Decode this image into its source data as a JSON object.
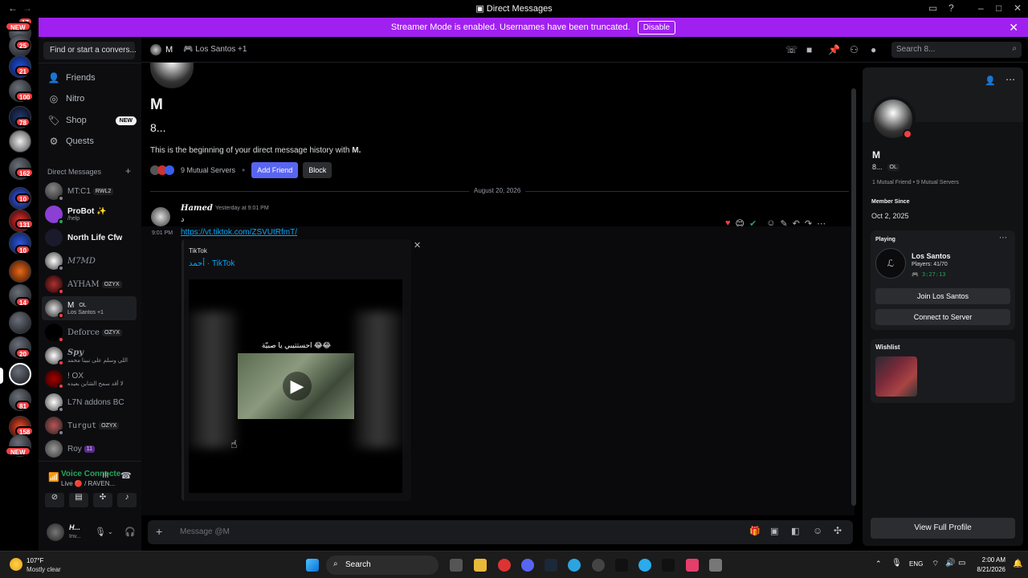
{
  "window": {
    "title": "Direct Messages"
  },
  "banner": {
    "text": "Streamer Mode is enabled. Usernames have been truncated.",
    "button": "Disable"
  },
  "rail": {
    "badges": [
      "17",
      "NEW",
      "25",
      "21",
      "100",
      "78",
      "162",
      "10",
      "131",
      "10",
      "14",
      "20",
      "81",
      "158",
      "NEW"
    ]
  },
  "sidebar": {
    "search_placeholder": "Find or start a convers...",
    "nav": [
      {
        "label": "Friends",
        "icon": "friends-icon"
      },
      {
        "label": "Nitro",
        "icon": "nitro-icon"
      },
      {
        "label": "Shop",
        "icon": "shop-icon",
        "badge": "NEW"
      },
      {
        "label": "Quests",
        "icon": "quests-icon"
      }
    ],
    "dm_header": "Direct Messages",
    "dms": [
      {
        "name": "MT:C1",
        "tag": "RWL2",
        "sub": ""
      },
      {
        "name": "ProBot ✨",
        "tag": "",
        "sub": "/help"
      },
      {
        "name": "North Life Cfw",
        "tag": "",
        "sub": ""
      },
      {
        "name": "M7MD",
        "tag": "",
        "sub": ""
      },
      {
        "name": "AYHAM",
        "tag": "OZYX",
        "sub": ""
      },
      {
        "name": "M",
        "tag": "OL",
        "sub": "Los Santos +1"
      },
      {
        "name": "Deforce",
        "tag": "OZYX",
        "sub": ""
      },
      {
        "name": "Spy",
        "tag": "",
        "sub": "اللي وسلم على نبينا محمد"
      },
      {
        "name": "! OX",
        "tag": "",
        "sub": "لا أقد سمح الشاين بعيده"
      },
      {
        "name": "L7N addons BC",
        "tag": "",
        "sub": ""
      },
      {
        "name": "Turgut",
        "tag": "OZYX",
        "sub": ""
      },
      {
        "name": "Roy",
        "tag": "11",
        "sub": ""
      }
    ],
    "voice": {
      "status": "Voice Connecte",
      "sub": "Live 🔴 / RAVEN..."
    },
    "user": {
      "name": "H...",
      "status": "Inv..."
    }
  },
  "header": {
    "name": "M",
    "activity": "Los Santos +1",
    "search_placeholder": "Search 8..."
  },
  "chat": {
    "big_name": "M",
    "username": "8...",
    "intro": "This is the beginning of your direct message history with ",
    "intro_name": "M.",
    "mutual_servers": "9 Mutual Servers",
    "add_friend": "Add Friend",
    "block": "Block",
    "date_divider": "August 20, 2026",
    "message": {
      "author": "Hamed",
      "time": "Yesterday at 9:01 PM",
      "text": "د",
      "side_time": "9:01 PM",
      "link": "https://vt.tiktok.com/ZSVUtRfmT/"
    },
    "embed": {
      "provider": "TikTok",
      "title": "أحمد · TikTok",
      "caption": "احستتيبي يا صبيّة 😂😂"
    },
    "composer_placeholder": "Message @M"
  },
  "profile": {
    "name": "M",
    "username": "8...",
    "tag": "OL",
    "mutual_friends": "1 Mutual Friend",
    "mutual_servers": "9 Mutual Servers",
    "member_since_label": "Member Since",
    "member_since": "Oct 2, 2025",
    "playing_label": "Playing",
    "game": "Los Santos",
    "players": "Players: 41/70",
    "elapsed": "3:27:13",
    "join_button": "Join Los Santos",
    "connect_button": "Connect to Server",
    "wishlist_label": "Wishlist",
    "view_full": "View Full Profile"
  },
  "taskbar": {
    "weather_temp": "107°F",
    "weather_desc": "Mostly clear",
    "search": "Search",
    "lang": "ENG",
    "time": "2:00 AM",
    "date": "8/21/2026"
  },
  "colors": {
    "accent": "#5865f2",
    "banner": "#a020f0",
    "danger": "#f23f43",
    "online": "#23a55a",
    "link": "#00a8fc"
  }
}
